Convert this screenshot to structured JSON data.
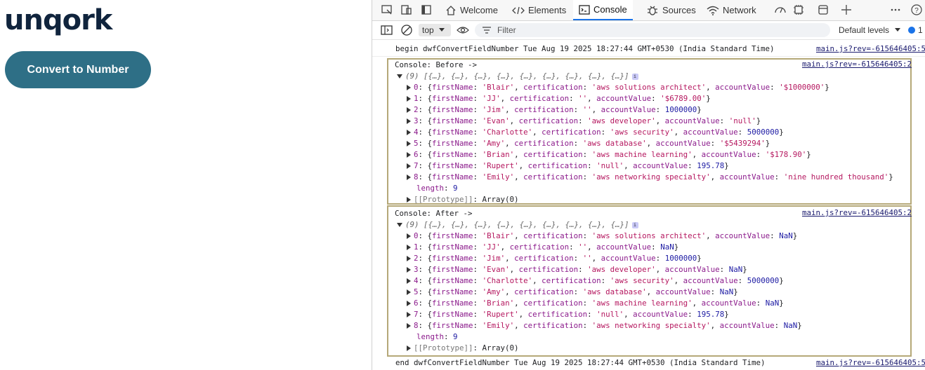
{
  "app": {
    "logo": "unqork",
    "convert_button": "Convert to Number"
  },
  "devtools": {
    "tabs": [
      {
        "label": "Welcome",
        "icon": "home-icon"
      },
      {
        "label": "Elements",
        "icon": "code-icon"
      },
      {
        "label": "Console",
        "icon": "console-icon",
        "active": true
      },
      {
        "label": "Sources",
        "icon": "bug-icon"
      },
      {
        "label": "Network",
        "icon": "wifi-icon"
      }
    ],
    "toolbar": {
      "context": "top",
      "filter_placeholder": "Filter",
      "levels": "Default levels",
      "issues_count": "1"
    },
    "messages": {
      "begin": "begin dwfConvertFieldNumber Tue Aug 19 2025 18:27:44 GMT+0530 (India Standard Time)",
      "end": "end dwfConvertFieldNumber Tue Aug 19 2025 18:27:44 GMT+0530 (India Standard Time)",
      "source": "main.js?rev=-615646405:5",
      "source_group": "main.js?rev=-615646405:2"
    },
    "before": {
      "title": "Console: Before ->",
      "summary": "(9) [{…}, {…}, {…}, {…}, {…}, {…}, {…}, {…}, {…}]",
      "rows": [
        {
          "i": "0",
          "firstName": "'Blair'",
          "certification": "'aws solutions architect'",
          "accountValue": "'$1000000'",
          "t": "str"
        },
        {
          "i": "1",
          "firstName": "'JJ'",
          "certification": "''",
          "accountValue": "'$6789.00'",
          "t": "str"
        },
        {
          "i": "2",
          "firstName": "'Jim'",
          "certification": "''",
          "accountValue": "1000000",
          "t": "num"
        },
        {
          "i": "3",
          "firstName": "'Evan'",
          "certification": "'aws developer'",
          "accountValue": "'null'",
          "t": "str"
        },
        {
          "i": "4",
          "firstName": "'Charlotte'",
          "certification": "'aws security'",
          "accountValue": "5000000",
          "t": "num"
        },
        {
          "i": "5",
          "firstName": "'Amy'",
          "certification": "'aws database'",
          "accountValue": "'$5439294'",
          "t": "str"
        },
        {
          "i": "6",
          "firstName": "'Brian'",
          "certification": "'aws machine learning'",
          "accountValue": "'$178.90'",
          "t": "str"
        },
        {
          "i": "7",
          "firstName": "'Rupert'",
          "certification": "'null'",
          "accountValue": "195.78",
          "t": "num"
        },
        {
          "i": "8",
          "firstName": "'Emily'",
          "certification": "'aws networking specialty'",
          "accountValue": "'nine hundred thousand'",
          "t": "str"
        }
      ],
      "length": "9",
      "prototype": "Array(0)"
    },
    "after": {
      "title": "Console: After ->",
      "summary": "(9) [{…}, {…}, {…}, {…}, {…}, {…}, {…}, {…}, {…}]",
      "rows": [
        {
          "i": "0",
          "firstName": "'Blair'",
          "certification": "'aws solutions architect'",
          "accountValue": "NaN",
          "t": "num"
        },
        {
          "i": "1",
          "firstName": "'JJ'",
          "certification": "''",
          "accountValue": "NaN",
          "t": "num"
        },
        {
          "i": "2",
          "firstName": "'Jim'",
          "certification": "''",
          "accountValue": "1000000",
          "t": "num"
        },
        {
          "i": "3",
          "firstName": "'Evan'",
          "certification": "'aws developer'",
          "accountValue": "NaN",
          "t": "num"
        },
        {
          "i": "4",
          "firstName": "'Charlotte'",
          "certification": "'aws security'",
          "accountValue": "5000000",
          "t": "num"
        },
        {
          "i": "5",
          "firstName": "'Amy'",
          "certification": "'aws database'",
          "accountValue": "NaN",
          "t": "num"
        },
        {
          "i": "6",
          "firstName": "'Brian'",
          "certification": "'aws machine learning'",
          "accountValue": "NaN",
          "t": "num"
        },
        {
          "i": "7",
          "firstName": "'Rupert'",
          "certification": "'null'",
          "accountValue": "195.78",
          "t": "num"
        },
        {
          "i": "8",
          "firstName": "'Emily'",
          "certification": "'aws networking specialty'",
          "accountValue": "NaN",
          "t": "num"
        }
      ],
      "length": "9",
      "prototype": "Array(0)"
    }
  }
}
